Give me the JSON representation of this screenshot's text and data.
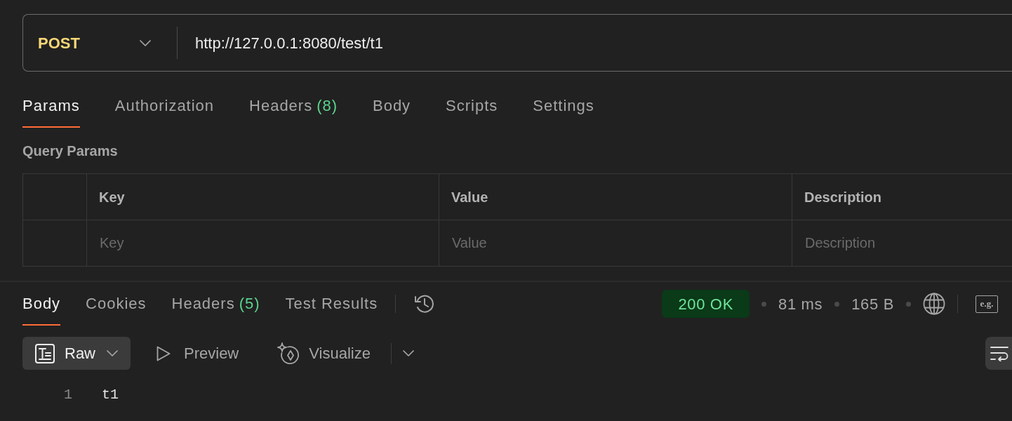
{
  "request": {
    "method": "POST",
    "url": "http://127.0.0.1:8080/test/t1"
  },
  "request_tabs": [
    {
      "label": "Params",
      "selected": true
    },
    {
      "label": "Authorization",
      "selected": false
    },
    {
      "label": "Headers",
      "count": "(8)",
      "selected": false
    },
    {
      "label": "Body",
      "selected": false
    },
    {
      "label": "Scripts",
      "selected": false
    },
    {
      "label": "Settings",
      "selected": false
    }
  ],
  "query_params": {
    "title": "Query Params",
    "columns": [
      "Key",
      "Value",
      "Description"
    ],
    "placeholders": [
      "Key",
      "Value",
      "Description"
    ]
  },
  "response_tabs": [
    {
      "label": "Body",
      "selected": true
    },
    {
      "label": "Cookies",
      "selected": false
    },
    {
      "label": "Headers",
      "count": "(5)",
      "selected": false
    },
    {
      "label": "Test Results",
      "selected": false
    }
  ],
  "response_meta": {
    "status": "200 OK",
    "time": "81 ms",
    "size": "165 B",
    "example_label": "e.g."
  },
  "body_view": {
    "modes": [
      {
        "kind": "format",
        "label": "Raw",
        "selected": true
      },
      {
        "kind": "preview",
        "label": "Preview",
        "selected": false
      },
      {
        "kind": "visualize",
        "label": "Visualize",
        "selected": false
      }
    ]
  },
  "code": [
    {
      "number": "1",
      "text": "t1"
    }
  ]
}
